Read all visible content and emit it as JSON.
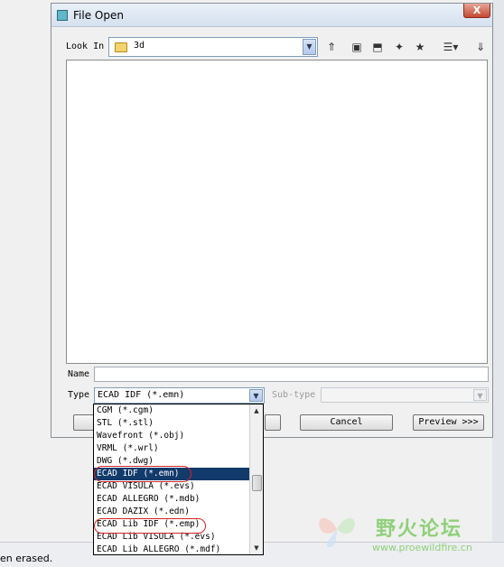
{
  "dialog": {
    "title": "File Open",
    "close_label": "X",
    "look_in_label": "Look In",
    "look_in_value": "3d",
    "name_label": "Name",
    "name_value": "",
    "type_label": "Type",
    "type_value": "ECAD IDF (*.emn)",
    "subtype_label": "Sub-type",
    "subtype_value": "",
    "buttons": {
      "cancel": "Cancel",
      "preview": "Preview >>>"
    }
  },
  "toolbar_icons": [
    "up-folder-icon",
    "desktop-icon",
    "open-folder-icon",
    "new-folder-icon",
    "working-dir-icon",
    "view-list-icon",
    "download-icon"
  ],
  "type_dropdown": {
    "items": [
      "CGM (*.cgm)",
      "STL (*.stl)",
      "Wavefront (*.obj)",
      "VRML (*.wrl)",
      "DWG (*.dwg)",
      "ECAD IDF (*.emn)",
      "ECAD VISULA (*.evs)",
      "ECAD ALLEGRO (*.mdb)",
      "ECAD DAZIX (*.edn)",
      "ECAD Lib IDF (*.emp)",
      "ECAD Lib VISULA (*.evs)",
      "ECAD Lib ALLEGRO (*.mdf)"
    ],
    "selected": "ECAD IDF (*.emn)"
  },
  "status_bar": {
    "text": "en erased."
  },
  "watermark": {
    "title": "野火论坛",
    "url": "www.proewildfire.cn"
  },
  "colors": {
    "selection": "#123a6b",
    "annotation": "#d42424",
    "watermark": "#8fd07a"
  }
}
